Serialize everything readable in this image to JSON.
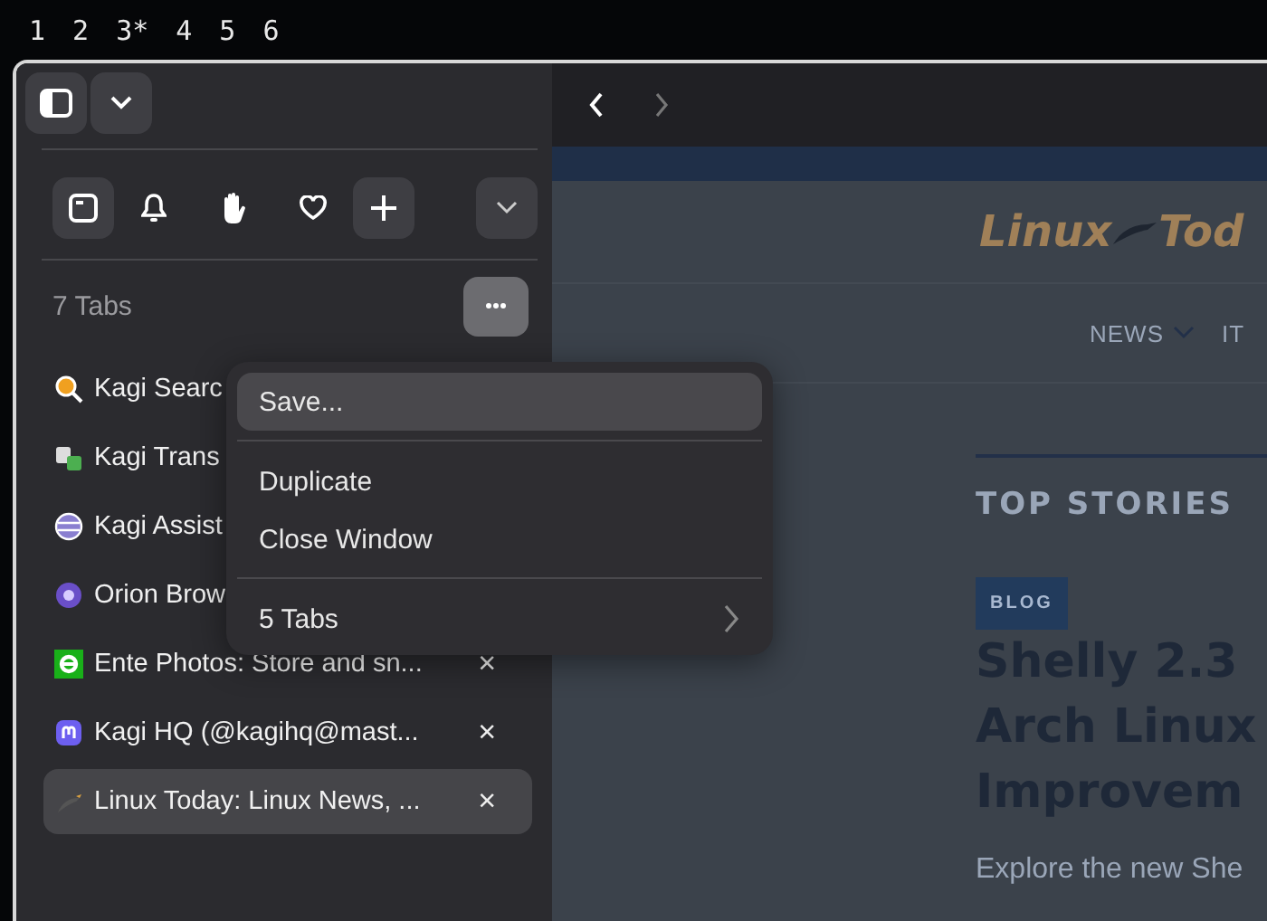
{
  "workspaces": [
    {
      "label": "1"
    },
    {
      "label": "2"
    },
    {
      "label": "3*"
    },
    {
      "label": "4"
    },
    {
      "label": "5"
    },
    {
      "label": "6"
    }
  ],
  "tab_count": "7 Tabs",
  "tabs": [
    {
      "title": "Kagi Searc",
      "kind": "search",
      "selected": false
    },
    {
      "title": "Kagi Trans",
      "kind": "translate",
      "selected": false
    },
    {
      "title": "Kagi Assist",
      "kind": "globe",
      "selected": false
    },
    {
      "title": "Orion Brow",
      "kind": "orb",
      "selected": false
    },
    {
      "title": "Ente Photos: Store and sn...",
      "kind": "ente",
      "close": "×",
      "selected": false
    },
    {
      "title": "Kagi HQ (@kagihq@mast...",
      "kind": "mastodon",
      "close": "×",
      "selected": false
    },
    {
      "title": "Linux Today: Linux News, ...",
      "kind": "bird",
      "close": "×",
      "selected": true
    }
  ],
  "menu": {
    "groups": [
      [
        {
          "label": "Save...",
          "kind": "item",
          "selected": true
        }
      ],
      [
        {
          "label": "Duplicate",
          "kind": "item",
          "selected": false
        },
        {
          "label": "Close Window",
          "kind": "item",
          "selected": false
        }
      ],
      [
        {
          "label": "5 Tabs",
          "kind": "submenu",
          "selected": false
        }
      ]
    ]
  },
  "page": {
    "logo": [
      "Linux",
      "Tod"
    ],
    "nav": [
      "NEWS",
      "IT"
    ],
    "section": "TOP STORIES",
    "tag": "BLOG",
    "headline": [
      "Shelly 2.3",
      "Arch Linux",
      "Improvem"
    ],
    "summary": "Explore the new She"
  }
}
